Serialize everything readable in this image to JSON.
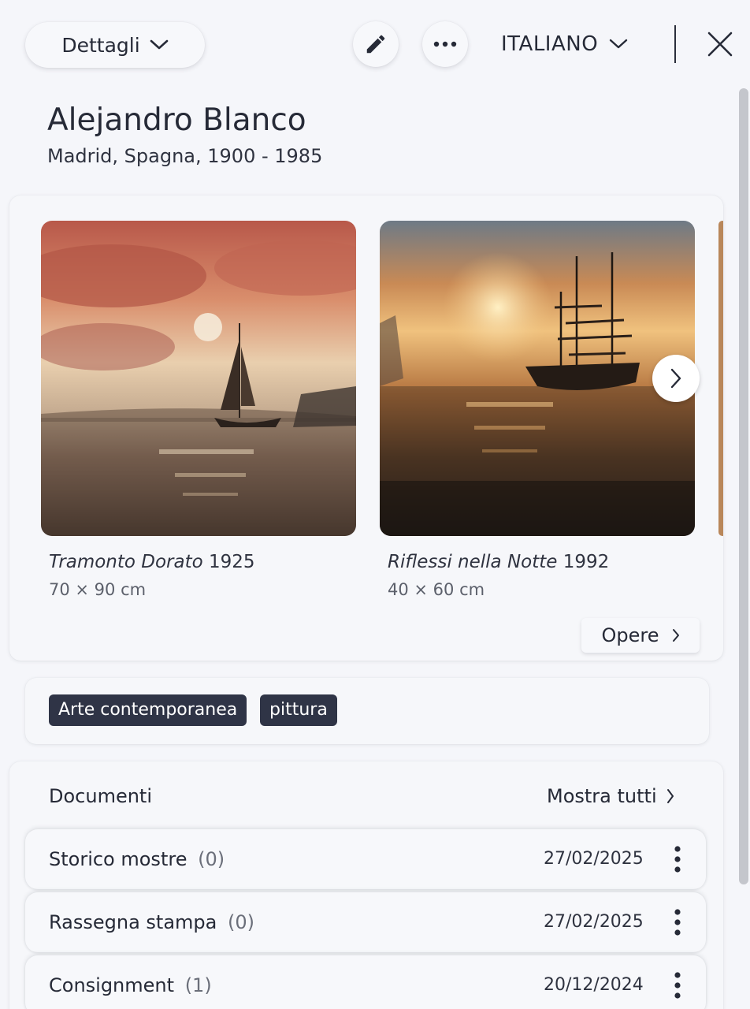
{
  "topbar": {
    "dropdown_label": "Dettagli",
    "language": "ITALIANO"
  },
  "artist": {
    "name": "Alejandro Blanco",
    "subtitle": "Madrid, Spagna, 1900 - 1985"
  },
  "artworks": [
    {
      "title": "Tramonto Dorato",
      "year": "1925",
      "size": "70 × 90 cm"
    },
    {
      "title": "Riflessi nella Notte",
      "year": "1992",
      "size": "40 × 60 cm"
    }
  ],
  "works_link": "Opere",
  "tags": [
    "Arte contemporanea",
    "pittura"
  ],
  "documents": {
    "title": "Documenti",
    "show_all": "Mostra tutti",
    "rows": [
      {
        "name": "Storico mostre",
        "count": "(0)",
        "date": "27/02/2025"
      },
      {
        "name": "Rassegna stampa",
        "count": "(0)",
        "date": "27/02/2025"
      },
      {
        "name": "Consignment",
        "count": "(1)",
        "date": "20/12/2024"
      }
    ]
  },
  "colors": {
    "background": "#f5f6fa",
    "text": "#262a37",
    "tag": "#2f3446",
    "scrollbar": "#c4c6cc"
  },
  "icons": [
    "chevron-down-icon",
    "pencil-icon",
    "more-horizontal-icon",
    "close-icon",
    "chevron-right-icon",
    "more-vertical-icon"
  ]
}
